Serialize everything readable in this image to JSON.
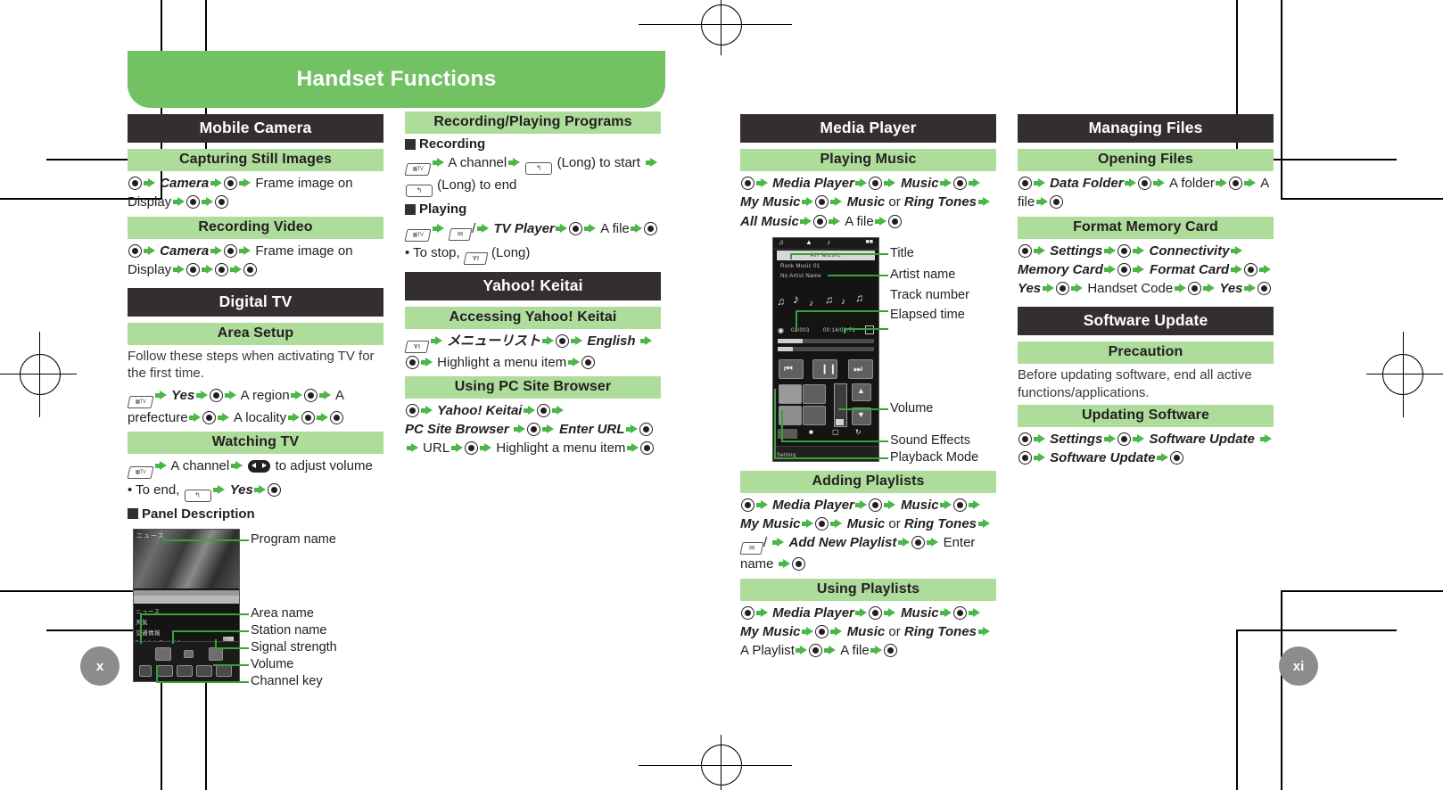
{
  "banner": {
    "title": "Handset Functions"
  },
  "folios": {
    "left": "x",
    "right": "xi"
  },
  "icons": {
    "select_key": "center-select-key-icon",
    "arrow": "green-arrow-icon",
    "tv_key": "tv-key-icon",
    "back_key": "back-key-icon",
    "mail_key": "mail-key-icon",
    "yahoo_key": "yahoo-key-icon",
    "volume_rocker": "volume-rocker-icon"
  },
  "colors": {
    "banner_green": "#72c163",
    "heading_dark": "#332f2e",
    "subheading_green": "#aedc9b",
    "arrow_green": "#4cb648",
    "leader_green": "#3aa03a",
    "folio_gray": "#8c8c8c"
  },
  "columns": {
    "mobile_camera": {
      "title": "Mobile Camera",
      "capturing": {
        "title": "Capturing Still Images",
        "line1_a": "Camera",
        "line1_b": "Frame image on",
        "line2_a": "Display"
      },
      "recording_video": {
        "title": "Recording Video",
        "line1_a": "Camera",
        "line1_b": "Frame image on",
        "line2_a": "Display"
      }
    },
    "digital_tv": {
      "title": "Digital TV",
      "area_setup": {
        "title": "Area Setup",
        "intro": "Follow these steps when activating TV for the first time.",
        "s_yes": "Yes",
        "s_region": "A region",
        "s_prefecture": "A prefecture",
        "s_locality": "A locality"
      },
      "watching_tv": {
        "title": "Watching TV",
        "s_channel": "A channel",
        "s_volume": "to adjust volume",
        "to_end_prefix": "• To end,",
        "s_yes": "Yes"
      },
      "panel_description": {
        "title": "Panel Description",
        "screen_text": {
          "program_jp": "ニュース",
          "rows": [
            "ニュース",
            "天気",
            "交通情報"
          ],
          "station_line": "Test 1ch Digital 1"
        },
        "labels": [
          "Program name",
          "Area name",
          "Station name",
          "Signal strength",
          "Volume",
          "Channel key"
        ]
      }
    },
    "recording_playing": {
      "title": "Recording/Playing Programs",
      "recording": {
        "title": "Recording",
        "s_channel": "A channel",
        "s_long_start": "(Long) to start",
        "s_long_end": "(Long) to end"
      },
      "playing": {
        "title": "Playing",
        "s_tv_player": "TV Player",
        "s_file": "A file",
        "to_stop": "• To stop,",
        "s_long": "(Long)"
      }
    },
    "yahoo_keitai": {
      "title": "Yahoo! Keitai",
      "accessing": {
        "title": "Accessing Yahoo! Keitai",
        "s_menu_list": "メニューリスト",
        "s_english": "English",
        "s_highlight": "Highlight a menu item"
      },
      "pc_site_browser": {
        "title": "Using PC Site Browser",
        "s_yahoo": "Yahoo! Keitai",
        "s_pc_site": "PC Site Browser",
        "s_enter_url": "Enter URL",
        "s_url": "URL",
        "s_highlight": "Highlight a menu item"
      }
    },
    "media_player": {
      "title": "Media Player",
      "playing_music": {
        "title": "Playing Music",
        "s_media_player": "Media Player",
        "s_music": "Music",
        "s_my_music": "My Music",
        "s_music2": "Music",
        "s_or": "or",
        "s_ring_tones": "Ring Tones",
        "s_all_music": "All Music",
        "s_file": "A file",
        "screen_text": {
          "title_bar": "All Music",
          "track": "Rock Music 01",
          "artist": "No Artist Name",
          "track_number": "02/003",
          "elapsed": "00:14/03:71",
          "footer": "Setting"
        },
        "labels": [
          "Title",
          "Artist name",
          "Track number",
          "Elapsed time",
          "Volume",
          "Sound Effects",
          "Playback Mode"
        ]
      },
      "adding_playlists": {
        "title": "Adding Playlists",
        "s_media_player": "Media Player",
        "s_music": "Music",
        "s_my_music": "My Music",
        "s_music2": "Music",
        "s_or": "or",
        "s_ring_tones": "Ring Tones",
        "s_add_new": "Add New Playlist",
        "s_enter_name": "Enter name"
      },
      "using_playlists": {
        "title": "Using Playlists",
        "s_media_player": "Media Player",
        "s_music": "Music",
        "s_my_music": "My Music",
        "s_music2": "Music",
        "s_or": "or",
        "s_ring_tones": "Ring Tones",
        "s_playlist": "A Playlist",
        "s_file": "A file"
      }
    },
    "managing_files": {
      "title": "Managing Files",
      "opening_files": {
        "title": "Opening Files",
        "s_data_folder": "Data Folder",
        "s_folder": "A folder",
        "s_file": "A file"
      },
      "format_memory_card": {
        "title": "Format Memory Card",
        "s_settings": "Settings",
        "s_connectivity": "Connectivity",
        "s_memory_card": "Memory Card",
        "s_format_card": "Format Card",
        "s_yes1": "Yes",
        "s_handset_code": "Handset Code",
        "s_yes2": "Yes"
      }
    },
    "software_update": {
      "title": "Software Update",
      "precaution": {
        "title": "Precaution",
        "text": "Before updating software, end all active functions/applications."
      },
      "updating_software": {
        "title": "Updating Software",
        "s_settings": "Settings",
        "s_software_update1": "Software Update",
        "s_software_update2": "Software Update"
      }
    }
  }
}
